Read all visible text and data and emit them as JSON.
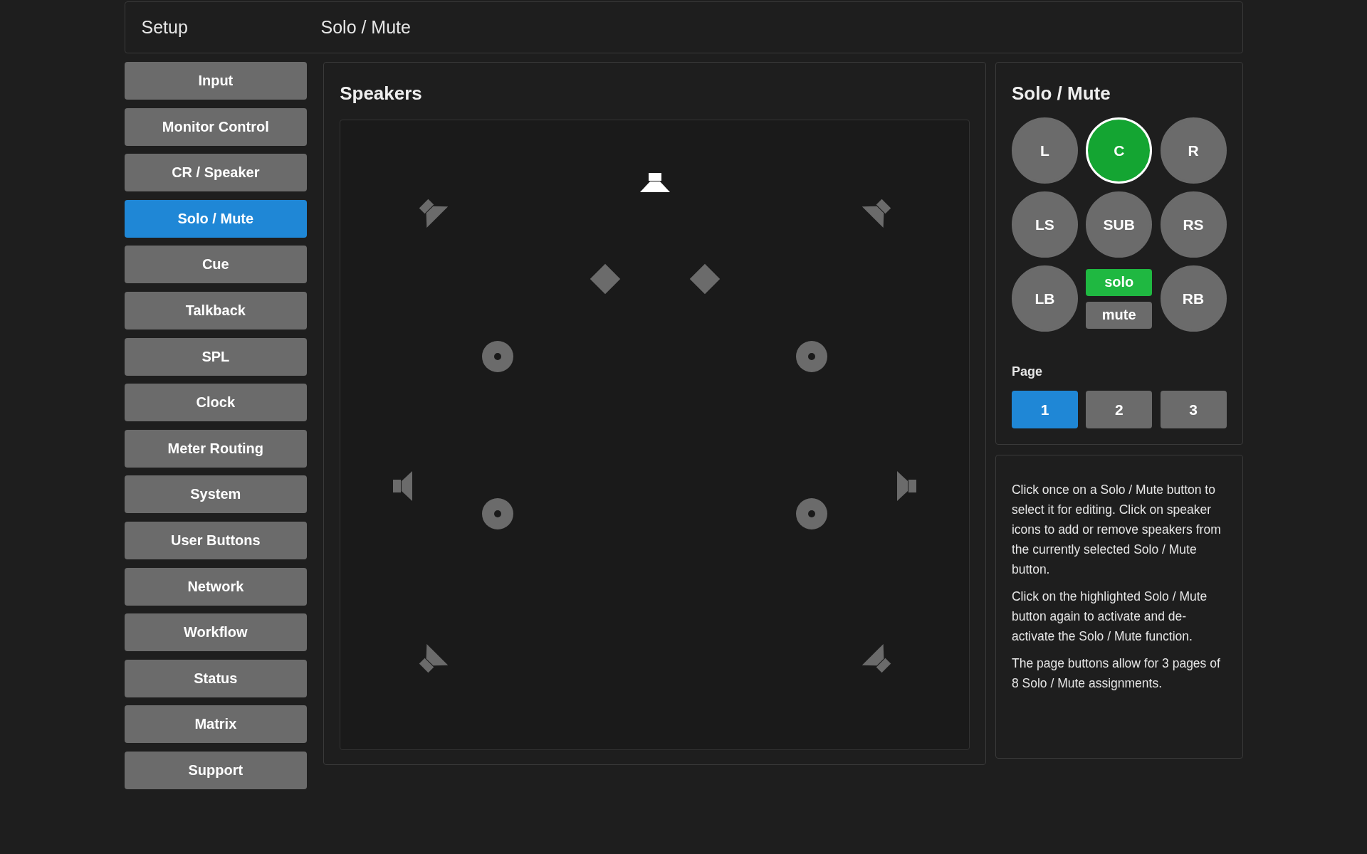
{
  "header": {
    "section": "Setup",
    "page": "Solo / Mute"
  },
  "sidebar": {
    "items": [
      {
        "label": "Input",
        "selected": false
      },
      {
        "label": "Monitor Control",
        "selected": false
      },
      {
        "label": "CR / Speaker",
        "selected": false
      },
      {
        "label": "Solo / Mute",
        "selected": true
      },
      {
        "label": "Cue",
        "selected": false
      },
      {
        "label": "Talkback",
        "selected": false
      },
      {
        "label": "SPL",
        "selected": false
      },
      {
        "label": "Clock",
        "selected": false
      },
      {
        "label": "Meter Routing",
        "selected": false
      },
      {
        "label": "System",
        "selected": false
      },
      {
        "label": "User Buttons",
        "selected": false
      },
      {
        "label": "Network",
        "selected": false
      },
      {
        "label": "Workflow",
        "selected": false
      },
      {
        "label": "Status",
        "selected": false
      },
      {
        "label": "Matrix",
        "selected": false
      },
      {
        "label": "Support",
        "selected": false
      }
    ]
  },
  "speakers_panel": {
    "title": "Speakers",
    "speakers": [
      {
        "kind": "center",
        "active": true
      },
      {
        "kind": "front-left",
        "active": false
      },
      {
        "kind": "front-right",
        "active": false
      },
      {
        "kind": "height-left",
        "active": false
      },
      {
        "kind": "height-right",
        "active": false
      },
      {
        "kind": "top-front-left",
        "active": false
      },
      {
        "kind": "top-front-right",
        "active": false
      },
      {
        "kind": "side-left",
        "active": false
      },
      {
        "kind": "side-right",
        "active": false
      },
      {
        "kind": "top-rear-left",
        "active": false
      },
      {
        "kind": "top-rear-right",
        "active": false
      },
      {
        "kind": "rear-left",
        "active": false
      },
      {
        "kind": "rear-right",
        "active": false
      }
    ]
  },
  "solo_mute_panel": {
    "title": "Solo / Mute",
    "buttons": [
      {
        "label": "L",
        "selected": false
      },
      {
        "label": "C",
        "selected": true
      },
      {
        "label": "R",
        "selected": false
      },
      {
        "label": "LS",
        "selected": false
      },
      {
        "label": "SUB",
        "selected": false
      },
      {
        "label": "RS",
        "selected": false
      },
      {
        "label": "LB",
        "selected": false
      },
      {
        "label": "RB",
        "selected": false
      }
    ],
    "mode_buttons": [
      {
        "label": "solo",
        "selected": true
      },
      {
        "label": "mute",
        "selected": false
      }
    ],
    "page_label": "Page",
    "pages": [
      {
        "label": "1",
        "selected": true
      },
      {
        "label": "2",
        "selected": false
      },
      {
        "label": "3",
        "selected": false
      }
    ]
  },
  "help": {
    "paragraphs": [
      "Click once on a Solo / Mute button to select it for editing. Click on speaker icons to add or remove speakers from the currently selected Solo / Mute button.",
      "Click on the highlighted Solo / Mute button again to activate and de-activate the Solo / Mute function.",
      "The page buttons allow for 3 pages of 8 Solo / Mute assignments."
    ]
  }
}
